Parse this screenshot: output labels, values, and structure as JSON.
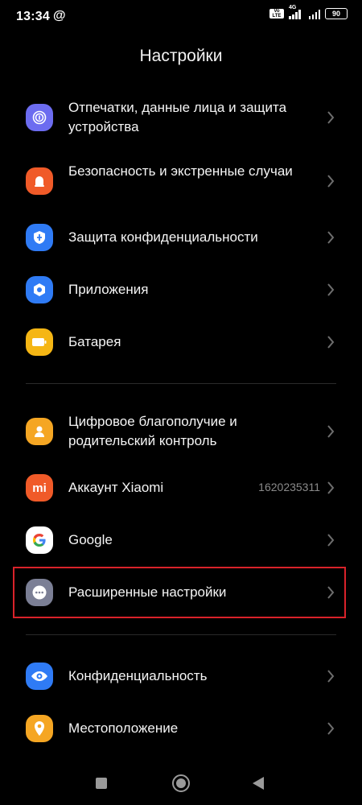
{
  "status_bar": {
    "time": "13:34",
    "at_symbol": "@",
    "volte": "Vo LTE",
    "network": "4G",
    "battery": "90"
  },
  "title": "Настройки",
  "items": [
    {
      "label": "Отпечатки, данные лица и защита устройства",
      "icon": "fingerprint-icon",
      "color": "#6c6cf0"
    },
    {
      "label": "Безопасность и экстренные случаи",
      "icon": "emergency-icon",
      "color": "#f05a28"
    },
    {
      "label": "Защита конфиденциальности",
      "icon": "privacy-protection-icon",
      "color": "#2f7bf5"
    },
    {
      "label": "Приложения",
      "icon": "apps-icon",
      "color": "#2f7bf5"
    },
    {
      "label": "Батарея",
      "icon": "battery-icon",
      "color": "#f5b614"
    },
    {
      "label": "Цифровое благополучие и родительский контроль",
      "icon": "wellbeing-icon",
      "color": "#f5a623"
    },
    {
      "label": "Аккаунт Xiaomi",
      "icon": "xiaomi-icon",
      "color": "#f05a28",
      "value": "1620235311"
    },
    {
      "label": "Google",
      "icon": "google-icon",
      "color": "#ffffff"
    },
    {
      "label": "Расширенные настройки",
      "icon": "more-settings-icon",
      "color": "#7b7f95"
    },
    {
      "label": "Конфиденциальность",
      "icon": "eye-icon",
      "color": "#2f7bf5"
    },
    {
      "label": "Местоположение",
      "icon": "location-icon",
      "color": "#f5a623"
    }
  ],
  "xiaomi_logo_text": "mi"
}
